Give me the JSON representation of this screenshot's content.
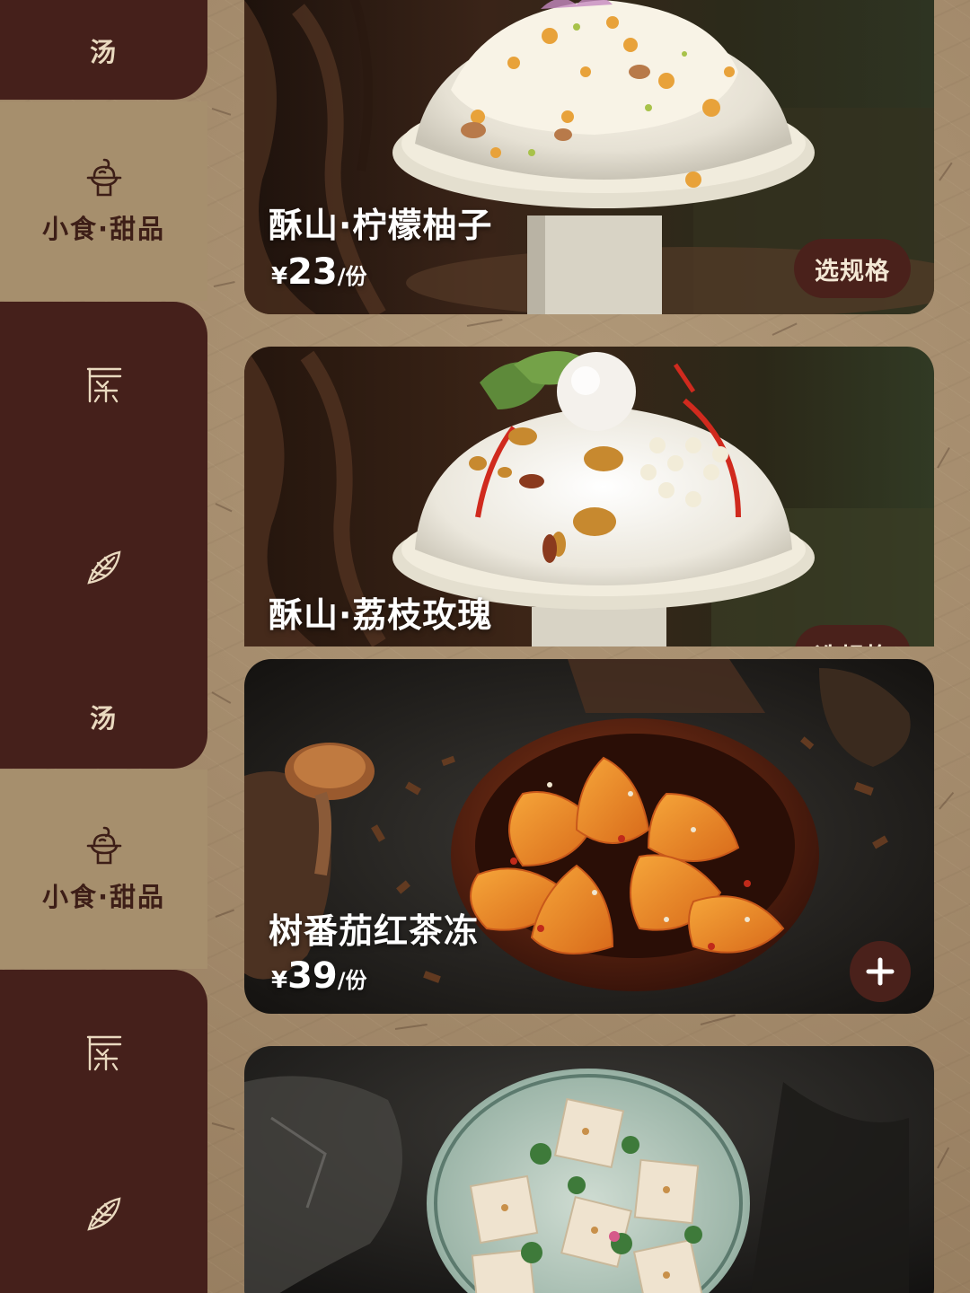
{
  "sidebar": {
    "items": [
      {
        "label": "汤"
      },
      {
        "label": "小食·甜品"
      },
      {
        "label": ""
      },
      {
        "label": ""
      },
      {
        "label": "汤"
      },
      {
        "label": "小食·甜品"
      },
      {
        "label": ""
      },
      {
        "label": ""
      }
    ]
  },
  "menu": {
    "items": [
      {
        "name": "酥山·柠檬柚子",
        "currency": "¥",
        "price": "23",
        "unit": "/份",
        "button": "选规格"
      },
      {
        "name": "酥山·荔枝玫瑰",
        "button": "选规格"
      },
      {
        "name": "树番茄红茶冻",
        "currency": "¥",
        "price": "39",
        "unit": "/份",
        "button": "+"
      },
      {
        "name": ""
      }
    ]
  },
  "colors": {
    "sidebar_dark": "#45201b",
    "sidebar_light": "#a68f6d",
    "button_bg": "#4a211b",
    "paper": "#a48c6c"
  },
  "icons": [
    "bowl-icon",
    "dessert-icon",
    "tea-icon",
    "leaf-icon"
  ]
}
